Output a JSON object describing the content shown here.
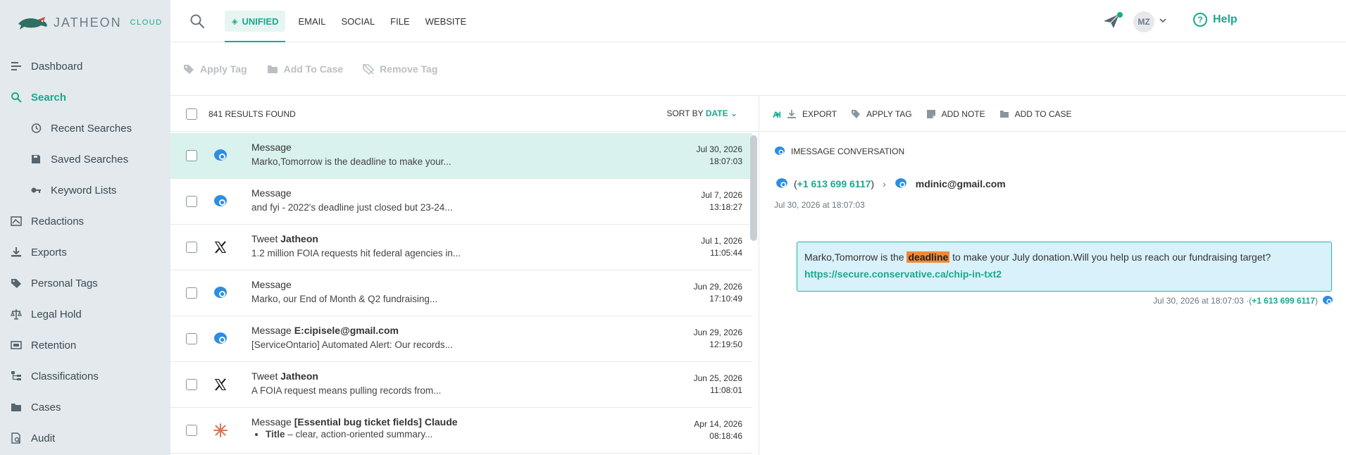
{
  "brand": {
    "name": "JATHEON",
    "suffix": "CLOUD"
  },
  "sidebar": {
    "items": [
      {
        "label": "Dashboard",
        "icon": "list-icon"
      },
      {
        "label": "Search",
        "icon": "search-icon",
        "active": true
      },
      {
        "label": "Recent Searches",
        "icon": "history-icon",
        "sub": true
      },
      {
        "label": "Saved Searches",
        "icon": "save-icon",
        "sub": true
      },
      {
        "label": "Keyword Lists",
        "icon": "key-icon",
        "sub": true
      },
      {
        "label": "Redactions",
        "icon": "redaction-icon"
      },
      {
        "label": "Exports",
        "icon": "download-icon"
      },
      {
        "label": "Personal Tags",
        "icon": "tag-icon"
      },
      {
        "label": "Legal Hold",
        "icon": "scale-icon"
      },
      {
        "label": "Retention",
        "icon": "retention-icon"
      },
      {
        "label": "Classifications",
        "icon": "hierarchy-icon"
      },
      {
        "label": "Cases",
        "icon": "folder-icon"
      },
      {
        "label": "Audit",
        "icon": "audit-icon"
      }
    ]
  },
  "topbar": {
    "tabs": [
      "UNIFIED",
      "EMAIL",
      "SOCIAL",
      "FILE",
      "WEBSITE"
    ],
    "help": "Help",
    "avatar": "MZ"
  },
  "actions": {
    "apply_tag": "Apply Tag",
    "add_to_case": "Add To Case",
    "remove_tag": "Remove Tag"
  },
  "results": {
    "count": "841 RESULTS FOUND",
    "sort_prefix": "SORT BY",
    "sort_field": "DATE",
    "rows": [
      {
        "type": "Message",
        "who": "",
        "preview": "Marko,Tomorrow is the deadline to make your...",
        "date": "Jul 30, 2026",
        "time": "18:07:03",
        "icon": "imessage-icon",
        "selected": true
      },
      {
        "type": "Message",
        "who": "",
        "preview": "and fyi - 2022's deadline just closed but 23-24...",
        "date": "Jul 7, 2026",
        "time": "13:18:27",
        "icon": "imessage-icon"
      },
      {
        "type": "Tweet",
        "who": "Jatheon",
        "preview": "1.2 million FOIA requests hit federal agencies in...",
        "date": "Jul 1, 2026",
        "time": "11:05:44",
        "icon": "x-icon"
      },
      {
        "type": "Message",
        "who": "",
        "preview": "Marko, our End of Month & Q2 fundraising...",
        "date": "Jun 29, 2026",
        "time": "17:10:49",
        "icon": "imessage-icon"
      },
      {
        "type": "Message",
        "who": "E:cipisele@gmail.com",
        "preview": "[ServiceOntario] Automated Alert: Our records...",
        "date": "Jun 29, 2026",
        "time": "12:19:50",
        "icon": "imessage-icon"
      },
      {
        "type": "Tweet",
        "who": "Jatheon",
        "preview": "A FOIA request means pulling records from...",
        "date": "Jun 25, 2026",
        "time": "11:08:01",
        "icon": "x-icon"
      },
      {
        "type": "Message",
        "who": "[Essential bug ticket fields] Claude",
        "preview_bold": "Title",
        "preview": " – clear, action-oriented summary...",
        "date": "Apr 14, 2026",
        "time": "08:18:46",
        "icon": "claude-icon"
      }
    ]
  },
  "detail": {
    "toolbar": {
      "ai": "AI",
      "export": "EXPORT",
      "apply_tag": "APPLY TAG",
      "add_note": "ADD NOTE",
      "add_to_case": "ADD TO CASE"
    },
    "conversation_label": "IMESSAGE CONVERSATION",
    "from": "+1 613 699 6117",
    "to": "mdinic@gmail.com",
    "timestamp": "Jul 30, 2026 at 18:07:03",
    "message": {
      "before": "Marko,Tomorrow is the ",
      "highlight": "deadline",
      "after": " to make your July donation.Will you help us reach our fundraising target?",
      "link": "https://secure.conservative.ca/chip-in-txt2"
    },
    "meta_time": "Jul 30, 2026 at 18:07:03 · ",
    "meta_sender": "+1 613 699 6117"
  },
  "colors": {
    "accent": "#1aa88e",
    "sidebar_bg": "#e3e9ed",
    "selected_row": "#d9f2ee",
    "highlight": "#f08a35"
  }
}
